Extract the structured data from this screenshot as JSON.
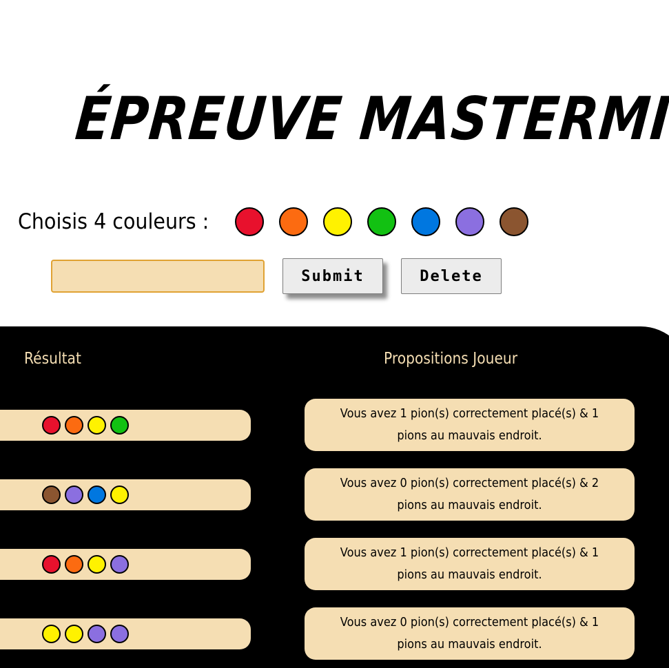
{
  "title": "ÉPREUVE MASTERMIND",
  "chooser": {
    "label": "Choisis 4 couleurs :",
    "colors": [
      {
        "name": "red",
        "hex": "#e8112d"
      },
      {
        "name": "orange",
        "hex": "#fc6b11"
      },
      {
        "name": "yellow",
        "hex": "#fff200"
      },
      {
        "name": "green",
        "hex": "#12c112"
      },
      {
        "name": "blue",
        "hex": "#0077e0"
      },
      {
        "name": "purple",
        "hex": "#8b6fe0"
      },
      {
        "name": "brown",
        "hex": "#8b5530"
      }
    ]
  },
  "form": {
    "input_value": "",
    "submit_label": "Submit",
    "delete_label": "Delete"
  },
  "board": {
    "left_header": "Résultat",
    "right_header": "Propositions Joueur",
    "rows": [
      {
        "pegs": [
          "#e8112d",
          "#fc6b11",
          "#fff200",
          "#12c112"
        ],
        "feedback": "Vous avez 1 pion(s) correctement placé(s) & 1 pions au mauvais endroit."
      },
      {
        "pegs": [
          "#8b5530",
          "#8b6fe0",
          "#0077e0",
          "#fff200"
        ],
        "feedback": "Vous avez 0 pion(s) correctement placé(s) & 2 pions au mauvais endroit."
      },
      {
        "pegs": [
          "#e8112d",
          "#fc6b11",
          "#fff200",
          "#8b6fe0"
        ],
        "feedback": "Vous avez 1 pion(s) correctement placé(s) & 1 pions au mauvais endroit."
      },
      {
        "pegs": [
          "#fff200",
          "#fff200",
          "#8b6fe0",
          "#8b6fe0"
        ],
        "feedback": "Vous avez 0 pion(s) correctement placé(s) & 1 pions au mauvais endroit."
      }
    ]
  }
}
